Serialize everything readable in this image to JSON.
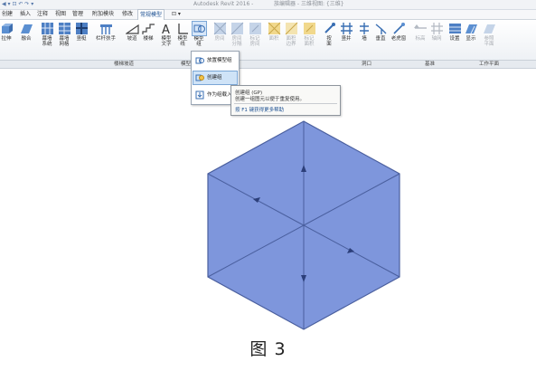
{
  "titlebar": {
    "app_title": "Autodesk Revit 2016 -",
    "file_name": "族编辑器 - 三维视图: {三维}"
  },
  "menubar": {
    "tabs": [
      "创建",
      "插入",
      "注释",
      "视图",
      "管理",
      "附加模块",
      "修改",
      "常规模型",
      "⊡ ▾"
    ],
    "active_index": 7
  },
  "ribbon": {
    "buttons": [
      {
        "label": "拉伸",
        "icon": "extrusion-icon"
      },
      {
        "label": "融合",
        "icon": "blend-icon"
      },
      {
        "label": "幕墙\n系统",
        "icon": "curtain-system-icon"
      },
      {
        "label": "幕墙\n网格",
        "icon": "curtain-grid-icon"
      },
      {
        "label": "竖梃",
        "icon": "mullion-icon"
      },
      {
        "label": "栏杆扶手",
        "icon": "railing-icon"
      },
      {
        "label": "坡道",
        "icon": "ramp-icon"
      },
      {
        "label": "楼梯",
        "icon": "stair-icon"
      },
      {
        "label": "模型\n文字",
        "icon": "model-text-icon"
      },
      {
        "label": "模型\n线",
        "icon": "model-line-icon"
      },
      {
        "label": "模型\n组",
        "icon": "model-group-icon"
      },
      {
        "label": "房间",
        "icon": "room-icon"
      },
      {
        "label": "房间\n分隔",
        "icon": "room-separator-icon"
      },
      {
        "label": "标记\n房间",
        "icon": "tag-room-icon"
      },
      {
        "label": "面积",
        "icon": "area-icon"
      },
      {
        "label": "面积\n边界",
        "icon": "area-boundary-icon"
      },
      {
        "label": "标记\n面积",
        "icon": "tag-area-icon"
      },
      {
        "label": "按\n面",
        "icon": "by-face-icon"
      },
      {
        "label": "竖井",
        "icon": "shaft-icon"
      },
      {
        "label": "墙",
        "icon": "wall-opening-icon"
      },
      {
        "label": "垂直",
        "icon": "vertical-opening-icon"
      },
      {
        "label": "老虎窗",
        "icon": "dormer-icon"
      },
      {
        "label": "标高",
        "icon": "level-icon"
      },
      {
        "label": "轴网",
        "icon": "grid-icon"
      },
      {
        "label": "设置",
        "icon": "set-workplane-icon"
      },
      {
        "label": "显示",
        "icon": "show-workplane-icon"
      },
      {
        "label": "参照\n平面",
        "icon": "reference-plane-icon"
      }
    ],
    "panels": [
      "楼梯坡道",
      "模型",
      "洞口",
      "基准",
      "工作平面"
    ]
  },
  "dropdown": {
    "items": [
      "放置模型组",
      "创建组",
      "作为组载入"
    ],
    "highlighted_index": 1
  },
  "tooltip": {
    "title": "创建组 (GP)",
    "description": "创建一组图元以便于重复使用。",
    "help": "按 F1 键获得更多帮助"
  },
  "cube": {
    "fill": "#7e96dc",
    "edge": "#4a5f9e",
    "arrow": "#2c3f7a"
  },
  "caption": "图 3"
}
